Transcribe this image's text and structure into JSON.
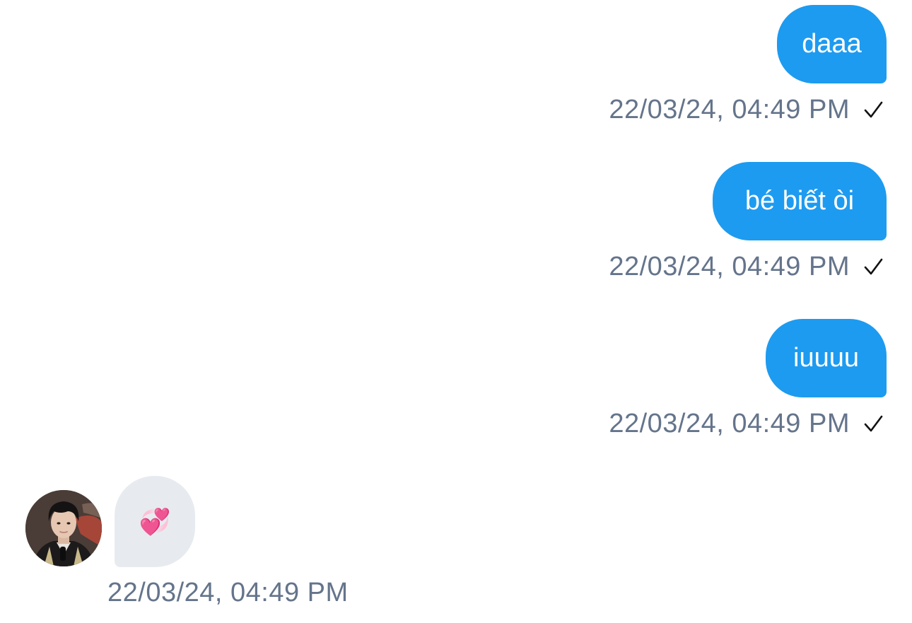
{
  "messages": [
    {
      "direction": "sent",
      "text": "daaa",
      "time": "22/03/24, 04:49 PM",
      "status": "sent-check"
    },
    {
      "direction": "sent",
      "text": "bé biết òi",
      "time": "22/03/24, 04:49 PM",
      "status": "sent-check"
    },
    {
      "direction": "sent",
      "text": "iuuuu",
      "time": "22/03/24, 04:49 PM",
      "status": "sent-check"
    },
    {
      "direction": "received",
      "text": "💞",
      "time": "22/03/24, 04:49 PM"
    }
  ],
  "colors": {
    "sent_bubble": "#1d9bf0",
    "received_bubble": "#e7ebef",
    "timestamp": "#64748b",
    "background": "#ffffff"
  },
  "icons": {
    "status": "check-icon",
    "avatar": "contact-avatar-photo"
  }
}
